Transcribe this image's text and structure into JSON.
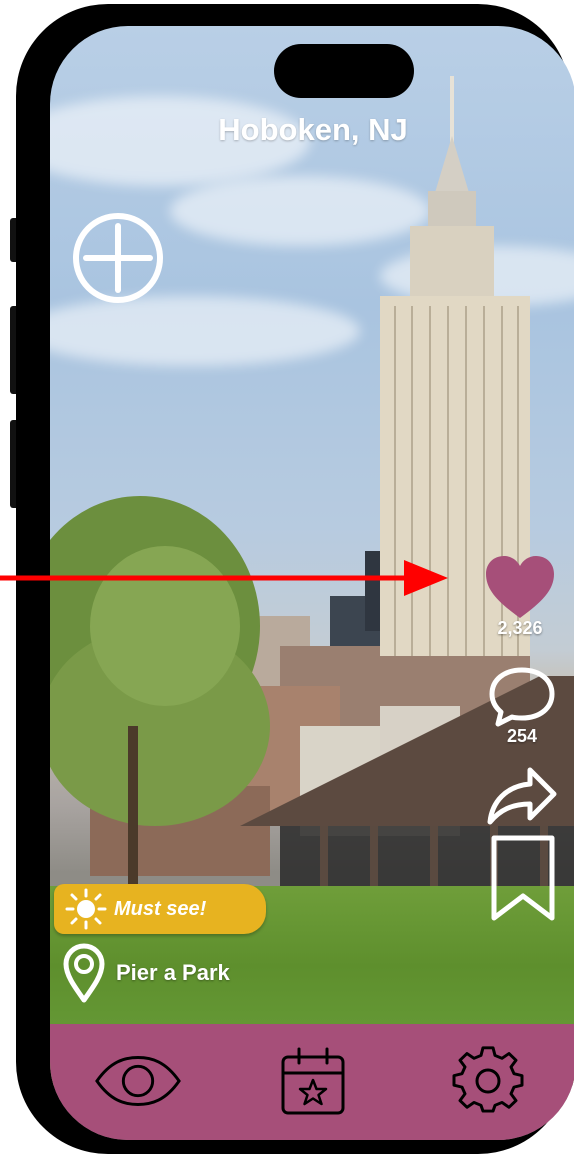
{
  "header": {
    "title": "Hoboken, NJ"
  },
  "actions": {
    "likes_count": "2,326",
    "comments_count": "254"
  },
  "post": {
    "badge_label": "Must see!",
    "location_name": "Pier a Park"
  },
  "icons": {
    "add": "plus-circle-icon",
    "like": "heart-icon",
    "comment": "speech-bubble-icon",
    "share": "share-arrow-icon",
    "save": "bookmark-icon",
    "badge": "sun-icon",
    "location": "map-pin-icon",
    "nav": [
      "eye-icon",
      "calendar-star-icon",
      "gear-icon"
    ]
  },
  "colors": {
    "accent": "#a64f79",
    "badge": "#e7b320",
    "annotation_arrow": "#ff0000"
  }
}
